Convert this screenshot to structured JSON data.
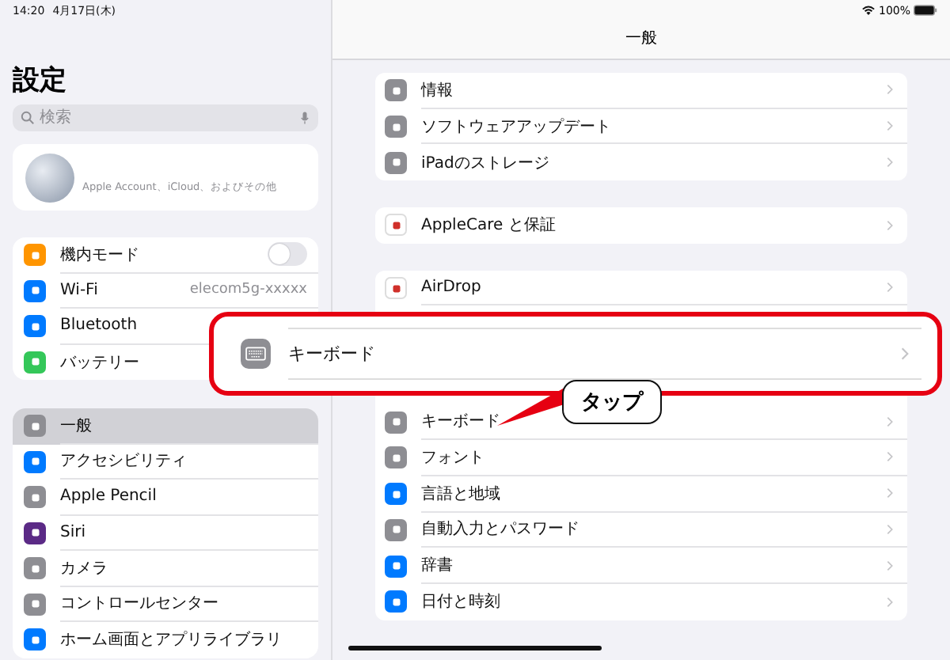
{
  "status_bar": {
    "time": "14:20",
    "date": "4月17日(木)",
    "battery": "100%"
  },
  "sidebar": {
    "title": "設定",
    "search": {
      "placeholder": "検索"
    },
    "account": {
      "subtitle": "Apple Account、iCloud、およびその他"
    },
    "groups": [
      {
        "items": [
          {
            "label": "機内モード",
            "kind": "toggle",
            "on": false,
            "color": "#ff9500",
            "selected": false
          },
          {
            "label": "Wi-Fi",
            "kind": "value",
            "value": "elecom5g-xxxxx",
            "color": "#007aff",
            "selected": false
          },
          {
            "label": "Bluetooth",
            "kind": "plain",
            "color": "#007aff",
            "selected": false
          },
          {
            "label": "バッテリー",
            "kind": "plain",
            "color": "#34c759",
            "selected": false
          }
        ]
      },
      {
        "items": [
          {
            "label": "一般",
            "kind": "plain",
            "color": "#8e8e93",
            "selected": true
          },
          {
            "label": "アクセシビリティ",
            "kind": "plain",
            "color": "#007aff",
            "selected": false
          },
          {
            "label": "Apple Pencil",
            "kind": "plain",
            "color": "#8e8e93",
            "selected": false
          },
          {
            "label": "Siri",
            "kind": "plain",
            "color": "#5b2a86",
            "selected": false
          },
          {
            "label": "カメラ",
            "kind": "plain",
            "color": "#8e8e93",
            "selected": false
          },
          {
            "label": "コントロールセンター",
            "kind": "plain",
            "color": "#8e8e93",
            "selected": false
          },
          {
            "label": "ホーム画面とアプリライブラリ",
            "kind": "plain",
            "color": "#007aff",
            "selected": false
          }
        ]
      }
    ]
  },
  "detail": {
    "title": "一般",
    "groups": [
      {
        "rows": [
          {
            "label": "情報",
            "color": "#8e8e93"
          },
          {
            "label": "ソフトウェアアップデート",
            "color": "#8e8e93"
          },
          {
            "label": "iPadのストレージ",
            "color": "#8e8e93"
          }
        ]
      },
      {
        "rows": [
          {
            "label": "AppleCare と保証",
            "color": "#ffffff"
          }
        ]
      },
      {
        "rows": [
          {
            "label": "AirDrop",
            "color": "#ffffff"
          },
          {
            "label": "キーボード",
            "color": "#8e8e93"
          },
          {
            "label": "フォント",
            "color": "#8e8e93"
          },
          {
            "label": "言語と地域",
            "color": "#007aff"
          },
          {
            "label": "自動入力とパスワード",
            "color": "#8e8e93"
          },
          {
            "label": "辞書",
            "color": "#007aff"
          },
          {
            "label": "日付と時刻",
            "color": "#007aff"
          }
        ]
      }
    ]
  },
  "highlight": {
    "label": "キーボード",
    "callout": "タップ"
  }
}
